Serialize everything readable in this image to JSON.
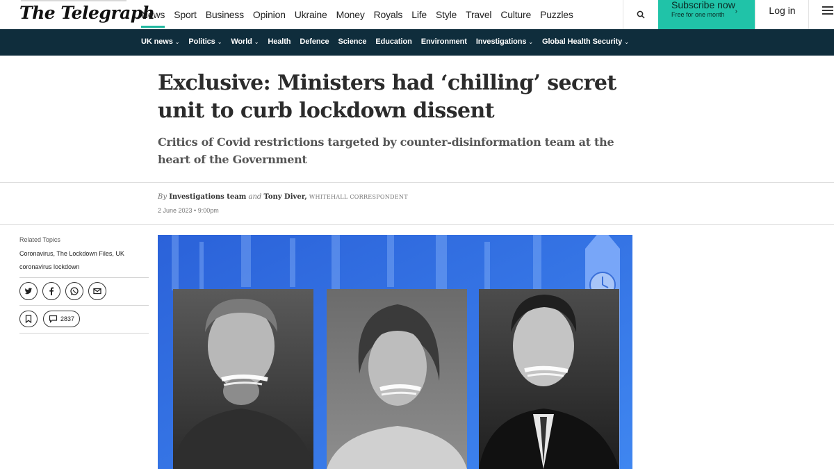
{
  "header": {
    "logo_text": "The Telegraph",
    "nav": [
      {
        "label": "News",
        "active": true
      },
      {
        "label": "Sport"
      },
      {
        "label": "Business"
      },
      {
        "label": "Opinion"
      },
      {
        "label": "Ukraine"
      },
      {
        "label": "Money"
      },
      {
        "label": "Royals"
      },
      {
        "label": "Life"
      },
      {
        "label": "Style"
      },
      {
        "label": "Travel"
      },
      {
        "label": "Culture"
      },
      {
        "label": "Puzzles"
      }
    ],
    "search_icon": "search-icon",
    "subscribe_title": "Subscribe now",
    "subscribe_sub": "Free for one month",
    "login_label": "Log in",
    "menu_icon": "hamburger-menu-icon",
    "accent_color": "#20c3a8"
  },
  "subnav": {
    "background": "#0f2d3c",
    "items": [
      {
        "label": "UK news",
        "dropdown": true
      },
      {
        "label": "Politics",
        "dropdown": true
      },
      {
        "label": "World",
        "dropdown": true
      },
      {
        "label": "Health",
        "dropdown": false
      },
      {
        "label": "Defence",
        "dropdown": false
      },
      {
        "label": "Science",
        "dropdown": false
      },
      {
        "label": "Education",
        "dropdown": false
      },
      {
        "label": "Environment",
        "dropdown": false
      },
      {
        "label": "Investigations",
        "dropdown": true
      },
      {
        "label": "Global Health Security",
        "dropdown": true
      }
    ]
  },
  "article": {
    "headline": "Exclusive: Ministers had ‘chilling’ secret unit to curb lockdown dissent",
    "standfirst": "Critics of Covid restrictions targeted by counter-disinformation team at the heart of the Government",
    "byline_by": "By",
    "author1": "Investigations team",
    "byline_and": "and",
    "author2": "Tony Diver,",
    "author2_role": "WHITEHALL CORRESPONDENT",
    "date": "2 June 2023 • 9:00pm"
  },
  "sidebar": {
    "related_title": "Related Topics",
    "topics_line1": "Coronavirus, The Lockdown Files, UK",
    "topics_line2": "coronavirus lockdown",
    "share_icons": [
      "twitter-icon",
      "facebook-icon",
      "whatsapp-icon",
      "email-icon"
    ],
    "bookmark_icon": "bookmark-icon",
    "comment_icon": "comment-icon",
    "comment_count": "2837"
  }
}
